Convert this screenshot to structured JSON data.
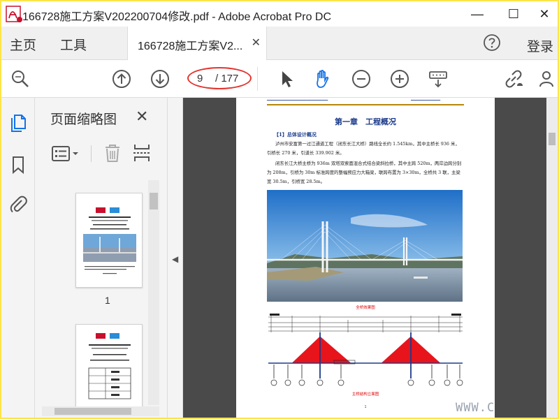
{
  "window": {
    "title": "166728施工方案V202200704修改.pdf - Adobe Acrobat Pro DC",
    "minimize": "—",
    "maximize": "☐",
    "close": "✕"
  },
  "menu": {
    "home": "主页",
    "tools": "工具",
    "tab_label": "166728施工方案V2...",
    "tab_close": "✕",
    "login": "登录"
  },
  "toolbar": {
    "current_page": "9",
    "total_pages": "/ 177",
    "icons": [
      "zoom-search-icon",
      "prev-page-icon",
      "next-page-icon",
      "select-pointer-icon",
      "hand-tool-icon",
      "zoom-out-icon",
      "zoom-in-icon",
      "keyboard-scroll-icon",
      "share-link-icon",
      "add-user-icon"
    ],
    "highlight_color": "#e3342f",
    "accent_color": "#1473e6"
  },
  "sidebar": {
    "panel_title": "页面缩略图",
    "panel_close": "✕",
    "thumbnails": [
      {
        "number": "1"
      }
    ]
  },
  "document": {
    "chapter_title": "第一章　工程概况",
    "section_title": "【1】总体设计概况",
    "paragraph1": "泸州市安富第一过江通道工程（闭东长江大桥）路线全长约 1.545km，其中主桥长 936 米，引桥长 270 米，引道长 339.902 米。",
    "paragraph2": "闭东长江大桥主桥为 936m 双塔双索面混合式结合梁斜拉桥，其中主跨 520m，两岸边跨分别为 208m，引桥为 30m 标准跨度的整幅预应力大箱梁，联跨布置为 3×30m，全桥共 3 联，主梁宽 30.5m，引桥宽 28.5m。",
    "photo_caption": "全桥效果图",
    "drawing_caption": "主桥结构立面图",
    "page_number": "1"
  },
  "watermark": "WWW.C"
}
